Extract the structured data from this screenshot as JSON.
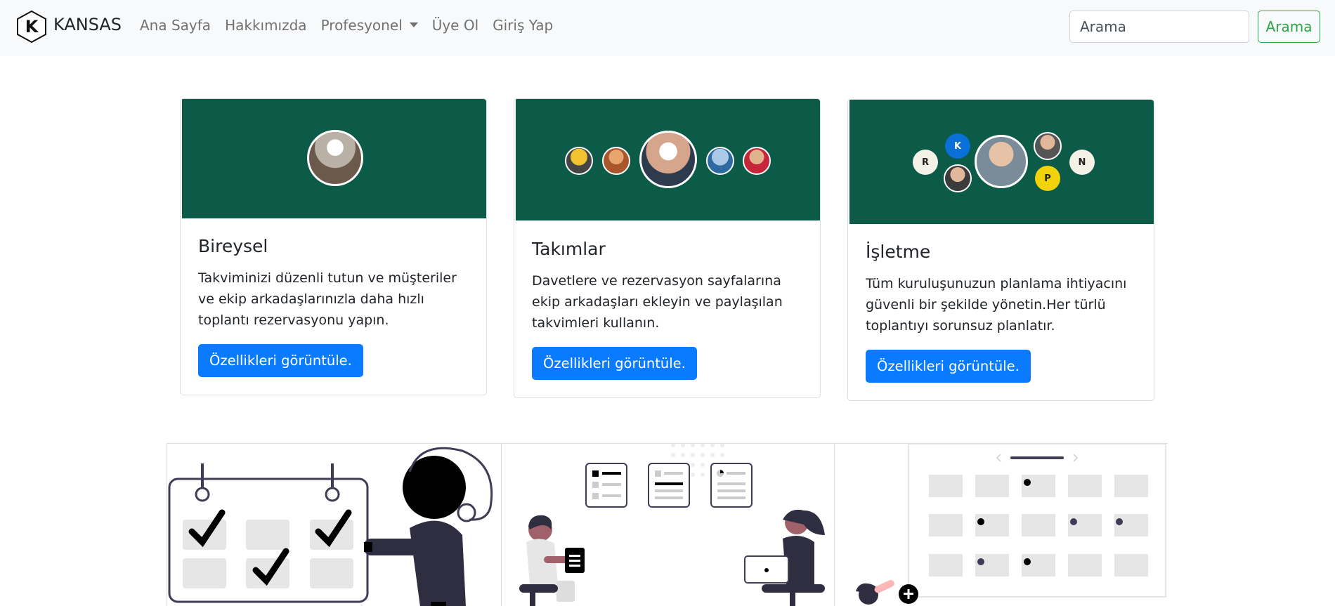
{
  "navbar": {
    "brand": "KANSAS",
    "brand_logo_letter": "K",
    "links": [
      "Ana Sayfa",
      "Hakkımızda",
      "Profesyonel",
      "Üye Ol",
      "Giriş Yap"
    ],
    "search_placeholder": "Arama",
    "search_button": "Arama",
    "search_button_color": "#28a745"
  },
  "cards": [
    {
      "title": "Bireysel",
      "text": "Takviminizi düzenli tutun ve müşteriler ve ekip arkadaşlarınızla daha hızlı toplantı rezervasyonu yapın.",
      "button": "Özellikleri görüntüle."
    },
    {
      "title": "Takımlar",
      "text": "Davetlere ve rezervasyon sayfalarına ekip arkadaşları ekleyin ve paylaşılan takvimleri kullanın.",
      "button": "Özellikleri görüntüle."
    },
    {
      "title": "İşletme",
      "text": "Tüm kuruluşunuzun planlama ihtiyacını güvenli bir şekilde yönetin.Her türlü toplantıyı sorunsuz planlatır.",
      "button": "Özellikleri görüntüle.",
      "avatar_letters": [
        "R",
        "K",
        "P",
        "N"
      ]
    }
  ],
  "colors": {
    "card_header_bg": "#0c5a48",
    "primary_button": "#0a7bff",
    "navbar_bg": "#f8f9fa"
  }
}
